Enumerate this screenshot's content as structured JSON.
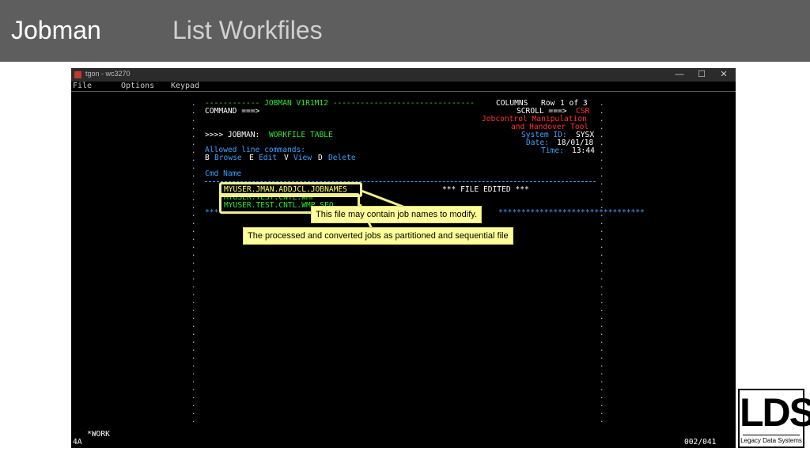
{
  "banner": {
    "title": "Jobman",
    "subtitle": "List Workfiles"
  },
  "window": {
    "title": "tgon - wc3270",
    "controls": {
      "minimize": "—",
      "maximize": "☐",
      "close": "✕"
    },
    "menu": [
      "File",
      "Options",
      "Keypad"
    ]
  },
  "terminal": {
    "header_left": "------------ JOBMAN V1R1M12 -------------------------------",
    "header_columns": "COLUMNS",
    "header_row_label": "Row",
    "header_row_value": "1 of 3",
    "command_label": "COMMAND ===>",
    "scroll_label": "SCROLL ===>",
    "scroll_value": "CSR",
    "tool_line1": "Jobcontrol Manipulation",
    "tool_line2": "and Handover Tool",
    "system_label": "System ID:",
    "system_value": "SYSX",
    "date_label": "Date:",
    "date_value": "18/01/18",
    "time_label": "Time:",
    "time_value": "13:44",
    "prompt": ">>>> JOBMAN:",
    "table_name": "WORKFILE TABLE",
    "allowed_label": "Allowed line commands:",
    "cmd_b": "B",
    "cmd_b_label": "Browse",
    "cmd_e": "E",
    "cmd_e_label": "Edit",
    "cmd_v": "V",
    "cmd_v_label": "View",
    "cmd_d": "D",
    "cmd_d_label": "Delete",
    "column_header": "Cmd Name",
    "rows": [
      "MYUSER.JMAN.ADDJCL.JOBNAMES",
      "MYUSER.TEST.CNTL.WMP",
      "MYUSER.TEST.CNTL.WMP.SEQ"
    ],
    "edited_notice": "*** FILE EDITED ***",
    "stars_tail": "********************************",
    "status_left": "4A",
    "status_work": "*WORK",
    "status_right": "002/041"
  },
  "callouts": {
    "first": "This file may contain job names to modify.",
    "second": "The processed and converted jobs as partitioned and sequential file"
  },
  "logo": {
    "letters": "LDS",
    "name": "Legacy Data Systems"
  },
  "colors": {
    "green": "#2ee52e",
    "blue": "#3aa0ff",
    "red": "#ff3030",
    "callout": "#ffff99"
  }
}
